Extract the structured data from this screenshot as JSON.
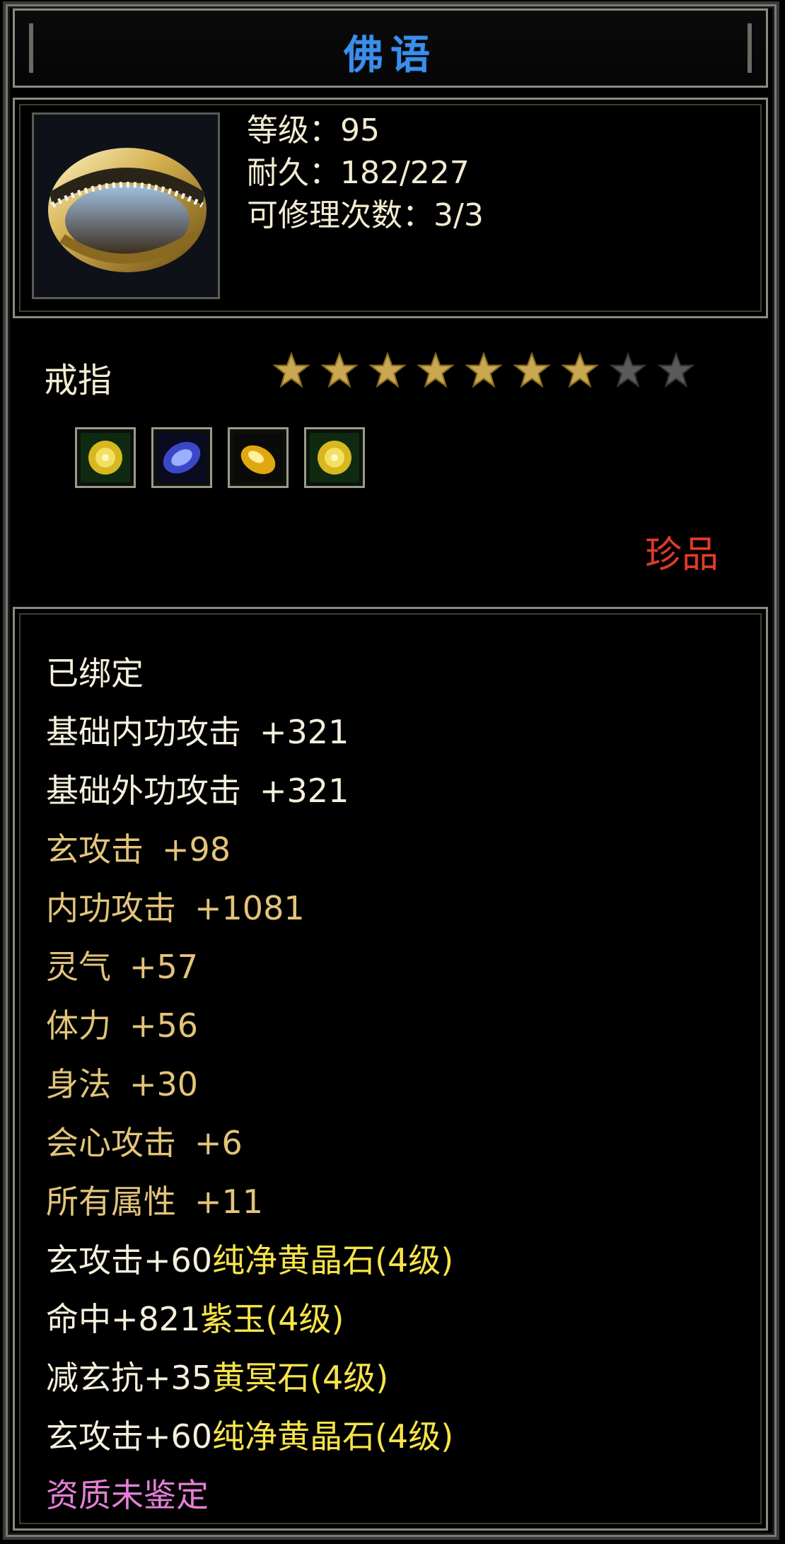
{
  "title": "佛语",
  "item": {
    "level": "等级：95",
    "durability": "耐久：182/227",
    "repair_count": "可修理次数：3/3",
    "type": "戒指",
    "stars_filled": 7,
    "stars_total": 9,
    "rarity": "珍品",
    "gems": [
      {
        "name": "yellow-crystal-gem-icon"
      },
      {
        "name": "purple-jade-gem-icon"
      },
      {
        "name": "yellow-dark-stone-gem-icon"
      },
      {
        "name": "yellow-crystal-gem-icon"
      }
    ]
  },
  "stats": {
    "bound": "已绑定",
    "lines": [
      {
        "label": "基础内功攻击",
        "value": "+321"
      },
      {
        "label": "基础外功攻击",
        "value": "+321"
      },
      {
        "label": "玄攻击",
        "value": "+98"
      },
      {
        "label": "内功攻击",
        "value": "+1081"
      },
      {
        "label": "灵气",
        "value": "+57"
      },
      {
        "label": "体力",
        "value": "+56"
      },
      {
        "label": "身法",
        "value": "+30"
      },
      {
        "label": "会心攻击",
        "value": "+6"
      },
      {
        "label": "所有属性",
        "value": "+11"
      }
    ],
    "gem_lines": [
      {
        "stat": "玄攻击+60",
        "gem": "纯净黄晶石(4级)"
      },
      {
        "stat": "命中+821",
        "gem": "紫玉(4级)"
      },
      {
        "stat": "减玄抗+35",
        "gem": "黄冥石(4级)"
      },
      {
        "stat": "玄攻击+60",
        "gem": "纯净黄晶石(4级)"
      }
    ],
    "quality": "资质未鉴定"
  },
  "colors": {
    "title": "#3b8eea",
    "rarity": "#e23a2a",
    "stat_tan": "#e2c47a",
    "gem_yellow": "#f6e44a",
    "quality_pink": "#e57fd6",
    "star_gold": "#c8a850",
    "star_gray": "#5a5a5a"
  }
}
